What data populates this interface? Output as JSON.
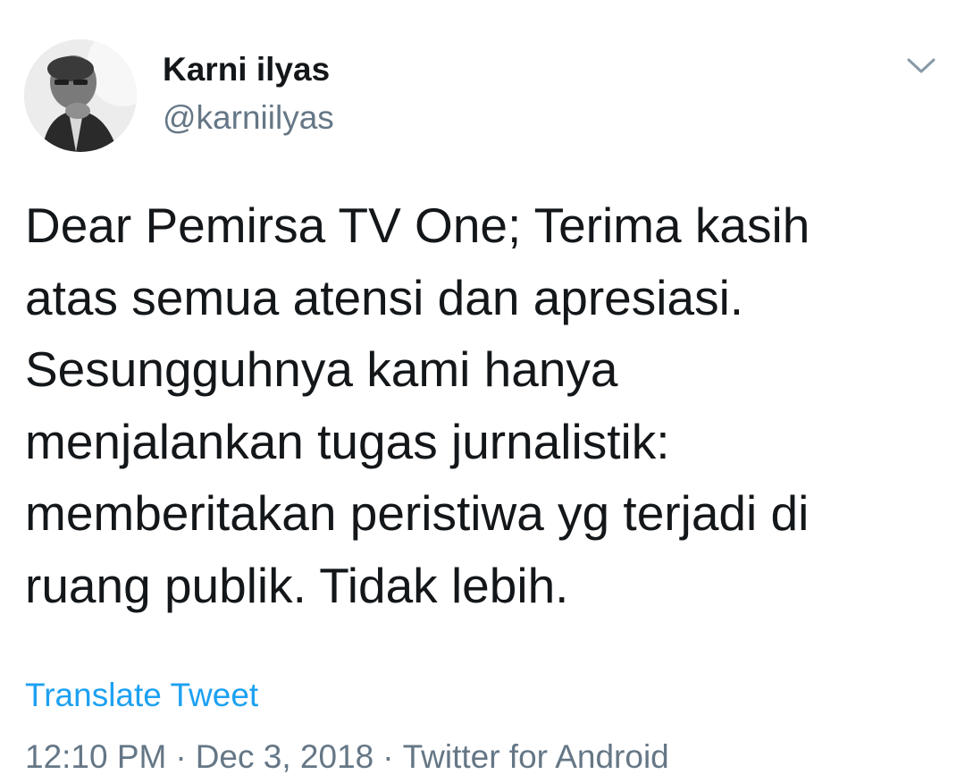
{
  "author": {
    "display_name": "Karni ilyas",
    "handle": "@karniilyas",
    "avatar_icon": "profile-photo"
  },
  "menu": {
    "caret_icon": "chevron-down-icon"
  },
  "tweet": {
    "lines": [
      "Dear Pemirsa TV One; Terima kasih",
      "atas semua atensi dan apresiasi.",
      "Sesungguhnya kami hanya",
      "menjalankan tugas jurnalistik:",
      "memberitakan peristiwa yg terjadi di",
      "ruang publik. Tidak lebih."
    ],
    "translate_label": "Translate Tweet"
  },
  "meta": {
    "time": "12:10 PM",
    "separator": "·",
    "date": "Dec 3, 2018",
    "source": "Twitter for Android"
  },
  "colors": {
    "text": "#14171a",
    "secondary": "#657786",
    "link": "#1da1f2"
  }
}
